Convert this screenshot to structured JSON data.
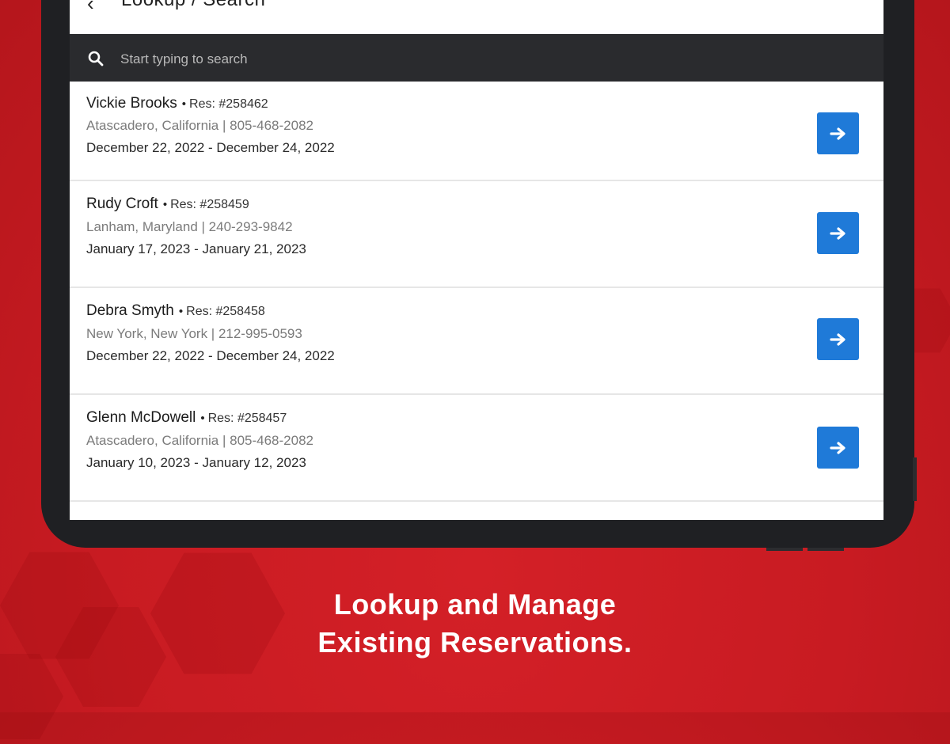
{
  "app": {
    "title": "Lookup / Search",
    "accent_color": "#1f7ad8",
    "background_color": "#c81b22"
  },
  "search": {
    "placeholder": "Start typing to search",
    "icon": "search-icon"
  },
  "reservations": [
    {
      "name": "Vickie Brooks",
      "separator": "•",
      "res_label": "Res: #258462",
      "location_phone": "Atascadero, California | 805-468-2082",
      "dates": "December 22, 2022 - December 24, 2022"
    },
    {
      "name": "Rudy Croft",
      "separator": "•",
      "res_label": "Res: #258459",
      "location_phone": "Lanham, Maryland | 240-293-9842",
      "dates": "January 17, 2023 - January 21, 2023"
    },
    {
      "name": "Debra Smyth",
      "separator": "•",
      "res_label": "Res: #258458",
      "location_phone": "New York, New York | 212-995-0593",
      "dates": "December 22, 2022 - December 24, 2022"
    },
    {
      "name": "Glenn McDowell",
      "separator": "•",
      "res_label": "Res: #258457",
      "location_phone": "Atascadero, California | 805-468-2082",
      "dates": "January 10, 2023 - January 12, 2023"
    }
  ],
  "tagline": {
    "line1": "Lookup and Manage",
    "line2": "Existing Reservations."
  }
}
